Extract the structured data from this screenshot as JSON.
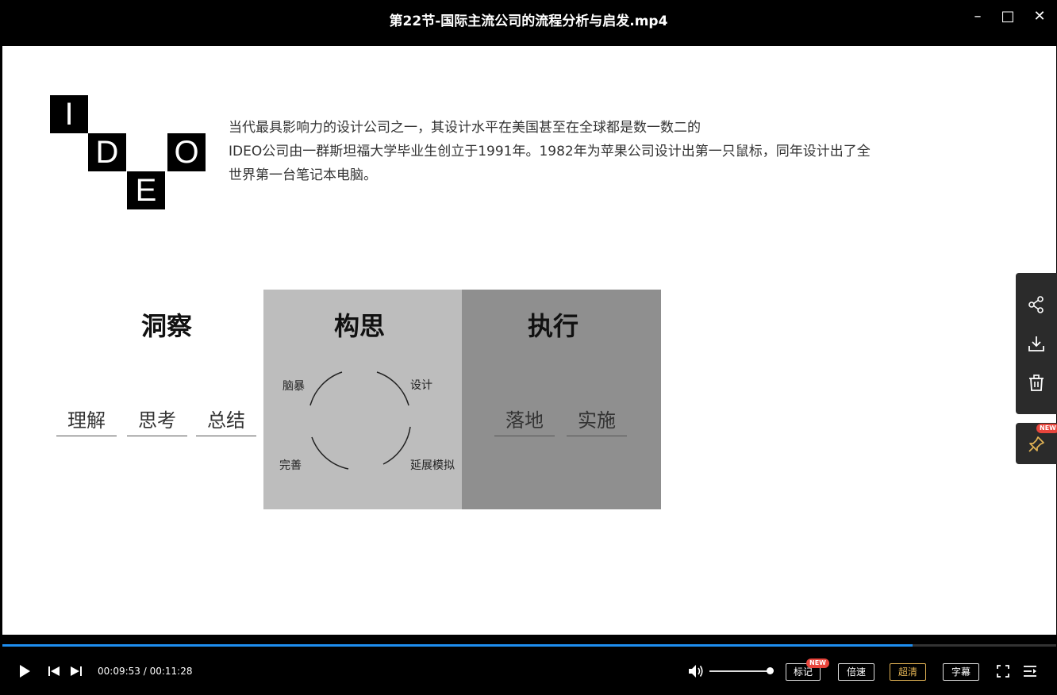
{
  "window": {
    "title": "第22节-国际主流公司的流程分析与启发.mp4",
    "minimize_symbol": "–",
    "maximize_symbol": "□",
    "close_symbol": "✕"
  },
  "slide": {
    "logo_letters": [
      "I",
      "D",
      "E",
      "O"
    ],
    "intro_lines": [
      "当代最具影响力的设计公司之一，其设计水平在美国甚至在全球都是数一数二的",
      "IDEO公司由一群斯坦福大学毕业生创立于1991年。1982年为苹果公司设计出第一只鼠标，同年设计出了全",
      "世界第一台笔记本电脑。"
    ],
    "columns": {
      "insight": {
        "title": "洞察",
        "words": [
          "理解",
          "思考",
          "总结"
        ]
      },
      "ideation": {
        "title": "构思",
        "cycle": [
          "脑暴",
          "设计",
          "延展模拟",
          "完善"
        ]
      },
      "execution": {
        "title": "执行",
        "words": [
          "落地",
          "实施"
        ]
      }
    }
  },
  "sidebar": {
    "items": [
      "share-icon",
      "download-icon",
      "delete-icon"
    ],
    "pin_badge": "NEW"
  },
  "player": {
    "progress": 0.864,
    "time": "00:09:53 / 00:11:28",
    "volume": 1.0,
    "buttons": {
      "mark": "标记",
      "mark_badge": "NEW",
      "speed": "倍速",
      "quality": "超清",
      "subtitle": "字幕"
    },
    "accent_color": "#1e8ef0",
    "quality_color": "#e3b455"
  }
}
